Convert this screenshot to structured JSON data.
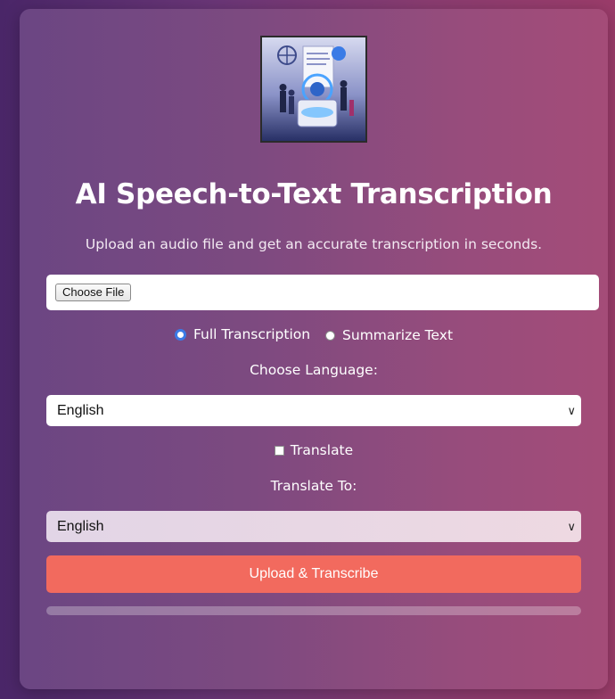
{
  "header": {
    "title": "AI Speech-to-Text Transcription",
    "subtitle": "Upload an audio file and get an accurate transcription in seconds."
  },
  "file_input": {
    "button_label": "Choose File"
  },
  "mode": {
    "options": [
      {
        "label": "Full Transcription",
        "checked": true
      },
      {
        "label": "Summarize Text",
        "checked": false
      }
    ]
  },
  "language": {
    "label": "Choose Language:",
    "selected": "English"
  },
  "translate": {
    "checkbox_label": "Translate",
    "checked": false,
    "to_label": "Translate To:",
    "selected": "English"
  },
  "actions": {
    "upload_label": "Upload & Transcribe"
  },
  "progress": {
    "value": 0
  },
  "colors": {
    "accent": "#f26a5e",
    "radio_accent": "#3b7ae6"
  }
}
